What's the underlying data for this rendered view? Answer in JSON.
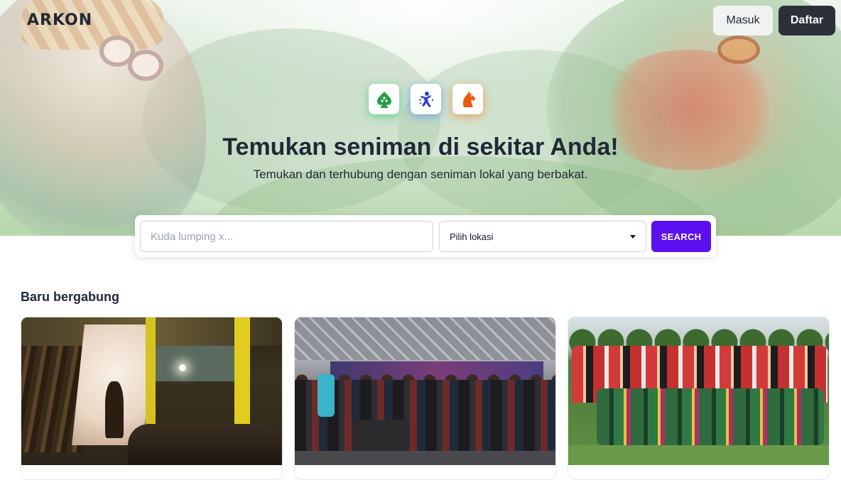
{
  "header": {
    "logo": "ARKON",
    "login_label": "Masuk",
    "register_label": "Daftar"
  },
  "hero": {
    "categories": [
      {
        "icon": "leaf-spade-icon",
        "color": "#22c55e"
      },
      {
        "icon": "dancer-icon",
        "color": "#3b82f6"
      },
      {
        "icon": "horse-icon",
        "color": "#f97316"
      }
    ],
    "title": "Temukan seniman di sekitar Anda!",
    "subtitle": "Temukan dan terhubung dengan seniman lokal yang berbakat."
  },
  "search": {
    "placeholder": "Kuda lumping x...",
    "location_placeholder": "Pilih lokasi",
    "button_label": "SEARCH"
  },
  "recent": {
    "title": "Baru bergabung",
    "cards": [
      {
        "image": "wayang shadow puppet performance"
      },
      {
        "image": "stage music performance"
      },
      {
        "image": "traditional dance group photo"
      }
    ]
  },
  "colors": {
    "accent": "#5b10f0",
    "dark_button": "#2b303b"
  }
}
